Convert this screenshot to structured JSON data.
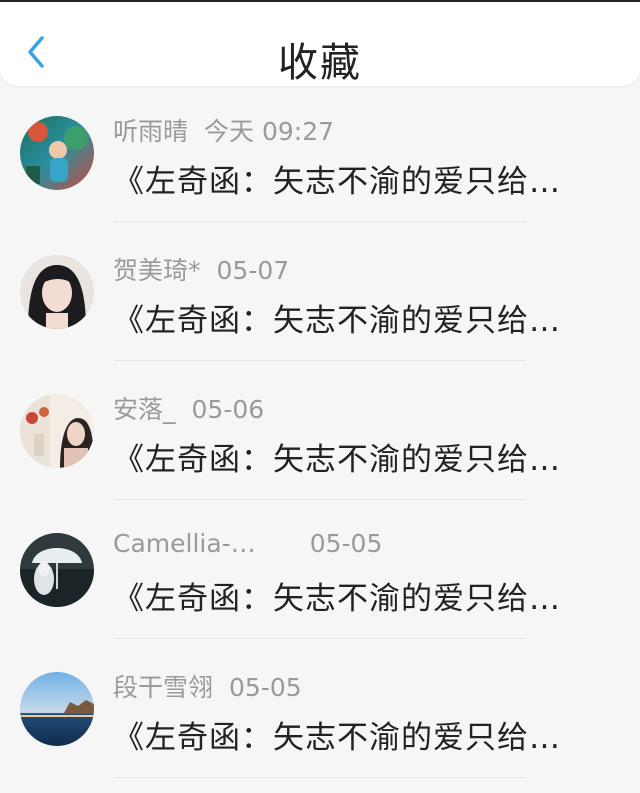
{
  "header": {
    "title": "收藏",
    "back_icon": "chevron-left-icon",
    "accent_color": "#3aa3e8"
  },
  "items": [
    {
      "name": "听雨晴",
      "time": "今天 09:27",
      "message": "《左奇函：矢志不渝的爱只给…"
    },
    {
      "name": "贺美琦*",
      "time": "05-07",
      "message": "《左奇函：矢志不渝的爱只给…"
    },
    {
      "name": "安落_",
      "time": "05-06",
      "message": "《左奇函：矢志不渝的爱只给…"
    },
    {
      "name": "Camellia-…",
      "time": "05-05",
      "message": "《左奇函：矢志不渝的爱只给…"
    },
    {
      "name": "段干雪翎",
      "time": "05-05",
      "message": "《左奇函：矢志不渝的爱只给…"
    }
  ]
}
